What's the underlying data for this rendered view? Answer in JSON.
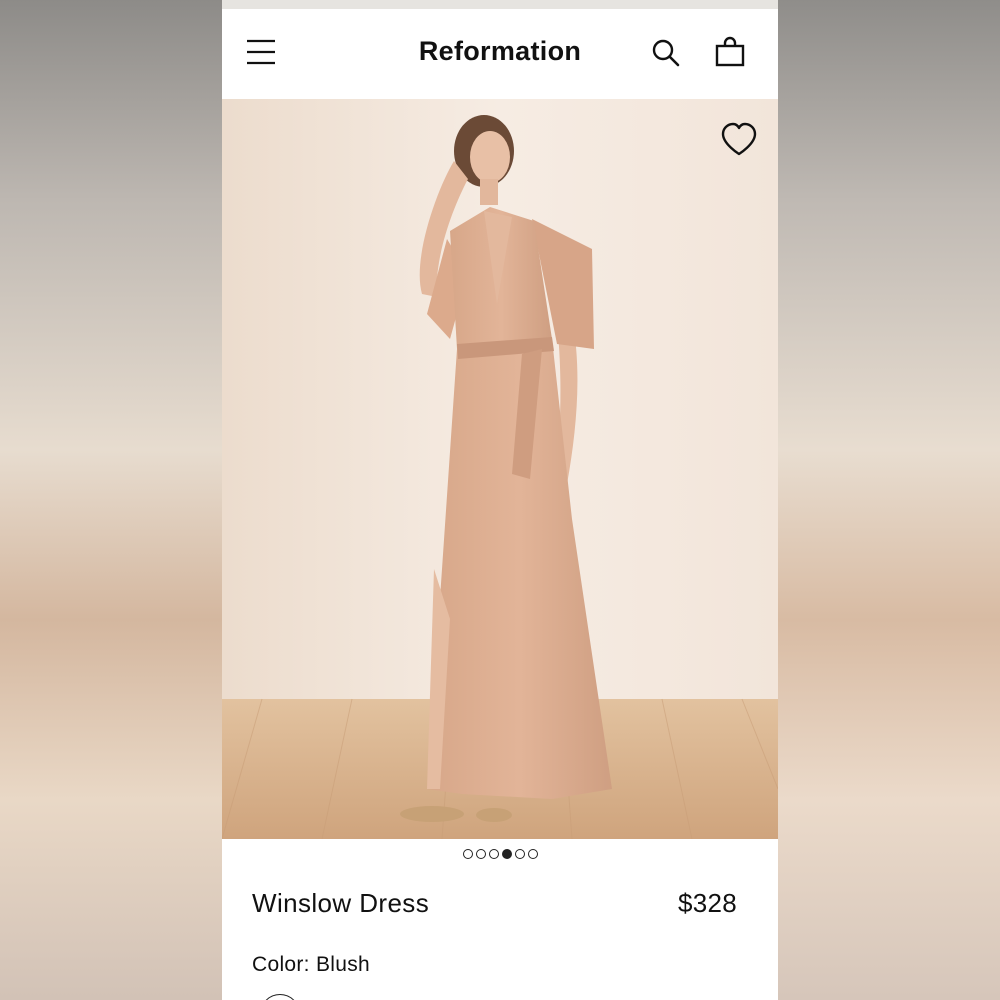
{
  "brand": "Reformation",
  "header": {
    "menu_icon": "hamburger-menu-icon",
    "search_icon": "search-icon",
    "bag_icon": "shopping-bag-icon"
  },
  "product": {
    "name": "Winslow Dress",
    "price": "$328",
    "color_label": "Color: Blush",
    "favorite_icon": "heart-icon"
  },
  "gallery": {
    "image_count": 6,
    "active_index": 3
  },
  "colors": {
    "dress": "#dcae92",
    "background": "#f1e4d9",
    "floor": "#d8b58f"
  }
}
